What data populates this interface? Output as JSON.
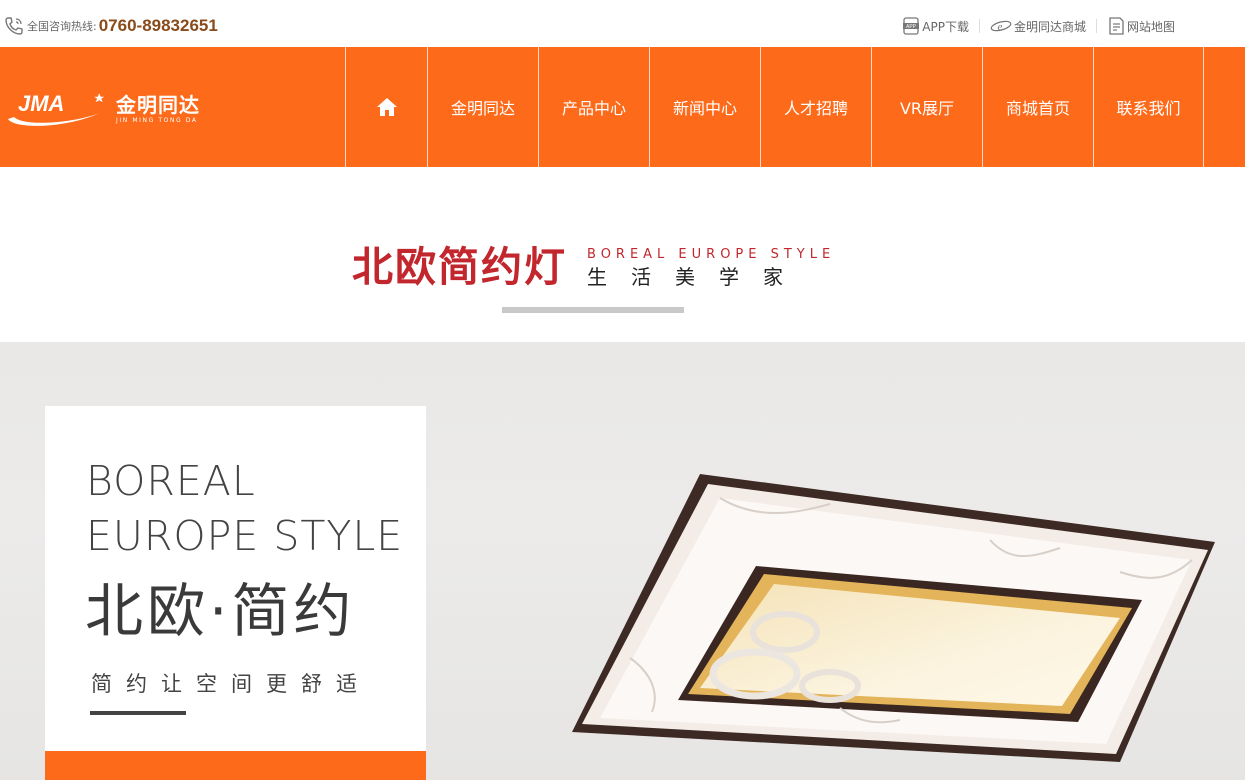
{
  "topbar": {
    "hotline_label": "全国咨询热线:",
    "hotline_number": "0760-89832651",
    "links": [
      {
        "label": "APP下载",
        "icon": "app-icon"
      },
      {
        "label": "金明同达商城",
        "icon": "ie-icon"
      },
      {
        "label": "网站地图",
        "icon": "sitemap-icon"
      }
    ]
  },
  "logo": {
    "cn": "金明同达",
    "en": "JIN MING TONG DA",
    "mark": "JMA"
  },
  "nav": {
    "home_icon": "home-icon",
    "items": [
      "金明同达",
      "产品中心",
      "新闻中心",
      "人才招聘",
      "VR展厅",
      "商城首页",
      "联系我们"
    ]
  },
  "headline": {
    "cn": "北欧简约灯",
    "en": "BOREAL EUROPE STYLE",
    "sub": "生活美学家"
  },
  "banner": {
    "en_line1": "BOREAL",
    "en_line2": "EUROPE STYLE",
    "cn": "北欧·简约",
    "sub": "简约让空间更舒适"
  },
  "colors": {
    "brand_orange": "#fd6a1a",
    "title_red": "#c2272d",
    "hotline_brown": "#8a4b1a"
  }
}
